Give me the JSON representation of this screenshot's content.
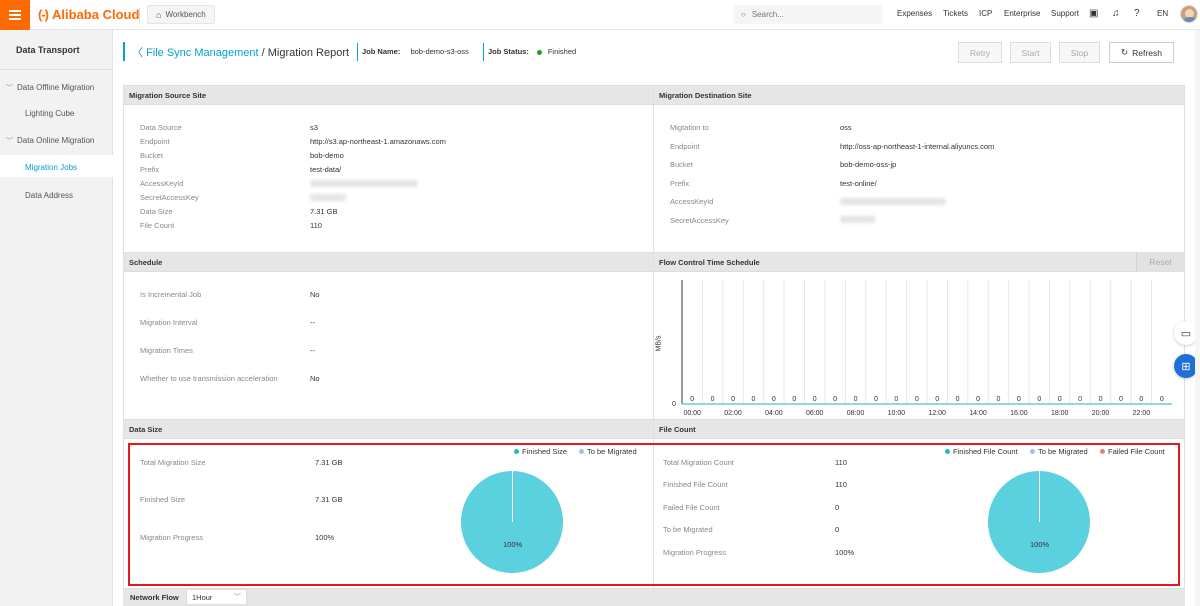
{
  "topbar": {
    "brand": "Alibaba Cloud",
    "brand_mark": "(-)",
    "workbench_label": "Workbench",
    "search_placeholder": "Search...",
    "nav": [
      "Expenses",
      "Tickets",
      "ICP",
      "Enterprise",
      "Support"
    ],
    "lang": "EN"
  },
  "sidebar": {
    "title": "Data Transport",
    "items": [
      {
        "label": "Data Offline Migration"
      },
      {
        "label": "Lighting Cube"
      },
      {
        "label": "Data Online Migration"
      },
      {
        "label": "Migration Jobs"
      },
      {
        "label": "Data Address"
      }
    ]
  },
  "header": {
    "breadcrumb_link": "File Sync Management",
    "breadcrumb_sep": " / ",
    "breadcrumb_current": "Migration Report",
    "job_name_label": "Job Name:",
    "job_name": "bob-demo-s3-oss",
    "job_status_label": "Job Status:",
    "job_status": "Finished",
    "status_color": "#1ea41e"
  },
  "actions": {
    "retry": "Retry",
    "start": "Start",
    "stop": "Stop",
    "refresh": "Refresh"
  },
  "source": {
    "title": "Migration Source Site",
    "rows": [
      {
        "label": "Data Source",
        "value": "s3"
      },
      {
        "label": "Endpoint",
        "value": "http://s3.ap-northeast-1.amazonaws.com"
      },
      {
        "label": "Bucket",
        "value": "bob-demo"
      },
      {
        "label": "Prefix",
        "value": "test-data/"
      },
      {
        "label": "AccessKeyId",
        "value": ""
      },
      {
        "label": "SecretAccessKey",
        "value": ""
      },
      {
        "label": "Data Size",
        "value": "7.31 GB"
      },
      {
        "label": "File Count",
        "value": "110"
      }
    ]
  },
  "destination": {
    "title": "Migration Destination Site",
    "rows": [
      {
        "label": "Migtation to",
        "value": "oss"
      },
      {
        "label": "Endpoint",
        "value": "http://oss-ap-northeast-1-internal.aliyuncs.com"
      },
      {
        "label": "Bucket",
        "value": "bob-demo-oss-jp"
      },
      {
        "label": "Prefix",
        "value": "test-online/"
      },
      {
        "label": "AccessKeyId",
        "value": ""
      },
      {
        "label": "SecretAccessKey",
        "value": ""
      }
    ]
  },
  "schedule": {
    "title": "Schedule",
    "rows": [
      {
        "label": "Is Incremental Job",
        "value": "No"
      },
      {
        "label": "Migration Interval",
        "value": "--"
      },
      {
        "label": "Migration Times",
        "value": "--"
      },
      {
        "label": "Whether to use transmission acceleration",
        "value": "No"
      }
    ]
  },
  "flow_control": {
    "title": "Flow Control Time Schedule",
    "reset": "Reset",
    "ylabel": "MB/s",
    "y_zero": "0",
    "x_ticks": [
      "00:00",
      "02:00",
      "04:00",
      "06:00",
      "08:00",
      "10:00",
      "12:00",
      "14:00",
      "16:00",
      "18:00",
      "20:00",
      "22:00"
    ],
    "values": [
      0,
      0,
      0,
      0,
      0,
      0,
      0,
      0,
      0,
      0,
      0,
      0,
      0,
      0,
      0,
      0,
      0,
      0,
      0,
      0,
      0,
      0,
      0,
      0
    ]
  },
  "data_size": {
    "title": "Data Size",
    "rows": [
      {
        "label": "Total Migration Size",
        "value": "7.31 GB"
      },
      {
        "label": "Finished Size",
        "value": "7.31 GB"
      },
      {
        "label": "Migration Progress",
        "value": "100%"
      }
    ],
    "legend": [
      {
        "name": "Finished Size",
        "color": "#1fbacb"
      },
      {
        "name": "To be Migrated",
        "color": "#a9bfe6"
      }
    ],
    "pie_label": "100%",
    "pie_fraction": 1.0
  },
  "file_count": {
    "title": "File Count",
    "rows": [
      {
        "label": "Total Migration Count",
        "value": "110"
      },
      {
        "label": "Finished File Count",
        "value": "110"
      },
      {
        "label": "Failed File Count",
        "value": "0"
      },
      {
        "label": "To be Migrated",
        "value": "0"
      },
      {
        "label": "Migration Progress",
        "value": "100%"
      }
    ],
    "legend": [
      {
        "name": "Finished File Count",
        "color": "#1fbacb"
      },
      {
        "name": "To be Migrated",
        "color": "#a9bfe6"
      },
      {
        "name": "Failed File Count",
        "color": "#f07b7b"
      }
    ],
    "pie_label": "100%",
    "pie_fraction": 1.0
  },
  "network_flow": {
    "title": "Network Flow",
    "select_value": "1Hour"
  },
  "colors": {
    "accent": "#00a2d4",
    "brand": "#ff6a00",
    "pie": "#5bd0df",
    "highlight": "#e4191c"
  },
  "icons": [
    "menu-icon",
    "workbench-icon",
    "search-icon",
    "console-icon",
    "bell-icon",
    "help-icon",
    "back-chevron-icon",
    "refresh-icon",
    "chat-icon",
    "apps-icon"
  ]
}
